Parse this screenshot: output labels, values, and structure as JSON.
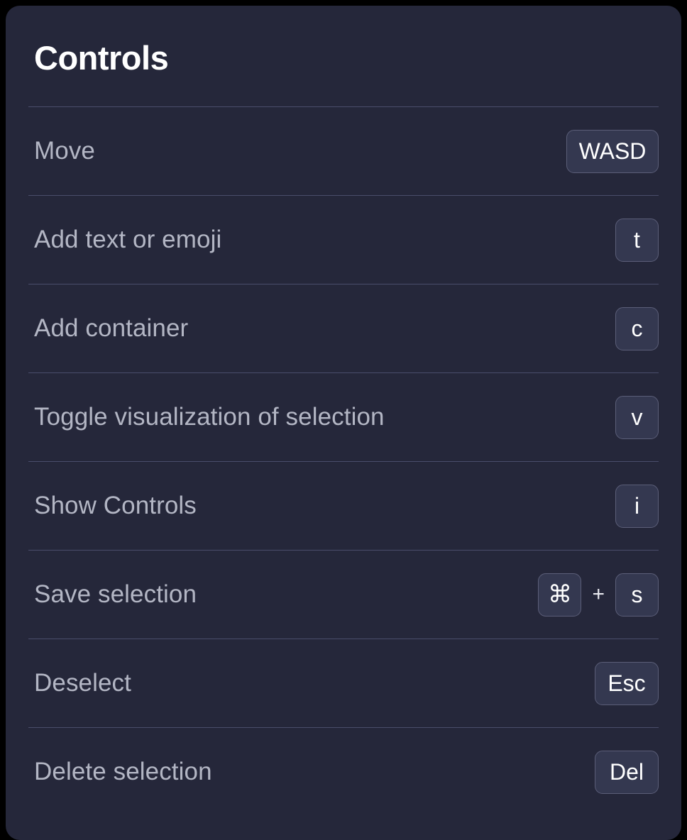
{
  "panel": {
    "title": "Controls",
    "accent_color": "#25273a",
    "badge_color": "#343850",
    "badge_border_color": "#5b5e78",
    "label_color": "#b3b6c4",
    "divider_color": "#4a4d6b",
    "title_color": "#ffffff",
    "backdrop_color": "#000000"
  },
  "rows": [
    {
      "label": "Move",
      "keys": [
        {
          "text": "WASD",
          "size": "wide",
          "icon": "keycap-wasd"
        }
      ]
    },
    {
      "label": "Add text or emoji",
      "keys": [
        {
          "text": "t",
          "size": "square",
          "icon": "keycap-t"
        }
      ]
    },
    {
      "label": "Add container",
      "keys": [
        {
          "text": "c",
          "size": "square",
          "icon": "keycap-c"
        }
      ]
    },
    {
      "label": "Toggle visualization of selection",
      "keys": [
        {
          "text": "v",
          "size": "square",
          "icon": "keycap-v"
        }
      ]
    },
    {
      "label": "Show Controls",
      "keys": [
        {
          "text": "i",
          "size": "square",
          "icon": "keycap-i"
        }
      ]
    },
    {
      "label": "Save selection",
      "keys": [
        {
          "text": "⌘",
          "size": "square",
          "icon": "keycap-command"
        },
        {
          "text": "+",
          "size": "separator",
          "icon": "plus-separator"
        },
        {
          "text": "s",
          "size": "square",
          "icon": "keycap-s"
        }
      ]
    },
    {
      "label": "Deselect",
      "keys": [
        {
          "text": "Esc",
          "size": "medium",
          "icon": "keycap-escape"
        }
      ]
    },
    {
      "label": "Delete selection",
      "keys": [
        {
          "text": "Del",
          "size": "medium",
          "icon": "keycap-delete"
        }
      ]
    }
  ]
}
